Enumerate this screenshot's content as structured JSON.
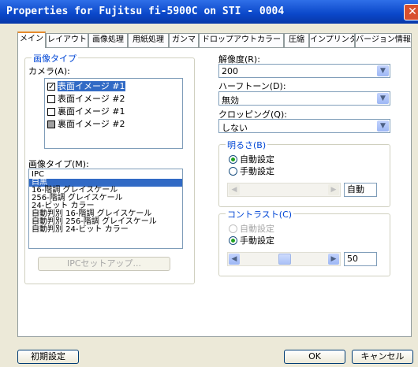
{
  "window": {
    "title": "Properties for Fujitsu fi-5900C on STI - 0004",
    "close_label": "✕"
  },
  "tabs": [
    {
      "label": "メイン"
    },
    {
      "label": "レイアウト"
    },
    {
      "label": "画像処理"
    },
    {
      "label": "用紙処理"
    },
    {
      "label": "ガンマ"
    },
    {
      "label": "ドロップアウトカラー"
    },
    {
      "label": "圧縮"
    },
    {
      "label": "インプリンタ"
    },
    {
      "label": "バージョン情報"
    }
  ],
  "image_type_group": {
    "title": "画像タイプ",
    "camera_label": "カメラ(A):",
    "camera_items": [
      {
        "label": "表面イメージ #1",
        "checked": true,
        "selected": true
      },
      {
        "label": "表面イメージ #2",
        "checked": false,
        "selected": false
      },
      {
        "label": "裏面イメージ #1",
        "checked": false,
        "selected": false
      },
      {
        "label": "裏面イメージ #2",
        "checked": false,
        "selected": false,
        "dim": true
      }
    ],
    "type_label": "画像タイプ(M):",
    "type_items": [
      {
        "label": "IPC"
      },
      {
        "label": "白黒"
      },
      {
        "label": "16-階調 グレイスケール"
      },
      {
        "label": "256-階調 グレイスケール"
      },
      {
        "label": "24-ビット カラー"
      },
      {
        "label": "自動判別 16-階調 グレイスケール"
      },
      {
        "label": "自動判別 256-階調 グレイスケール"
      },
      {
        "label": "自動判別 24-ビット カラー"
      }
    ],
    "selected_type": "白黒",
    "ipc_button": "IPCセットアップ..."
  },
  "right": {
    "resolution_label": "解像度(R):",
    "resolution_value": "200",
    "halftone_label": "ハーフトーン(D):",
    "halftone_value": "無効",
    "cropping_label": "クロッピング(Q):",
    "cropping_value": "しない",
    "brightness": {
      "title": "明るさ(B)",
      "auto": "自動設定",
      "manual": "手動設定",
      "value": "自動",
      "selected": "auto"
    },
    "contrast": {
      "title": "コントラスト(C)",
      "auto": "自動設定",
      "manual": "手動設定",
      "value": "50",
      "selected": "manual",
      "level": 0.5
    }
  },
  "footer": {
    "default_button": "初期設定",
    "ok_button": "OK",
    "cancel_button": "キャンセル"
  },
  "icons": {
    "combo_arrow": "▼",
    "left_arrow": "◀",
    "right_arrow": "▶"
  },
  "colors": {
    "group_title": "#0046d5",
    "selection": "#316ac5",
    "titlebar": "#0a47c9",
    "tab_accent": "#e68b2c"
  }
}
